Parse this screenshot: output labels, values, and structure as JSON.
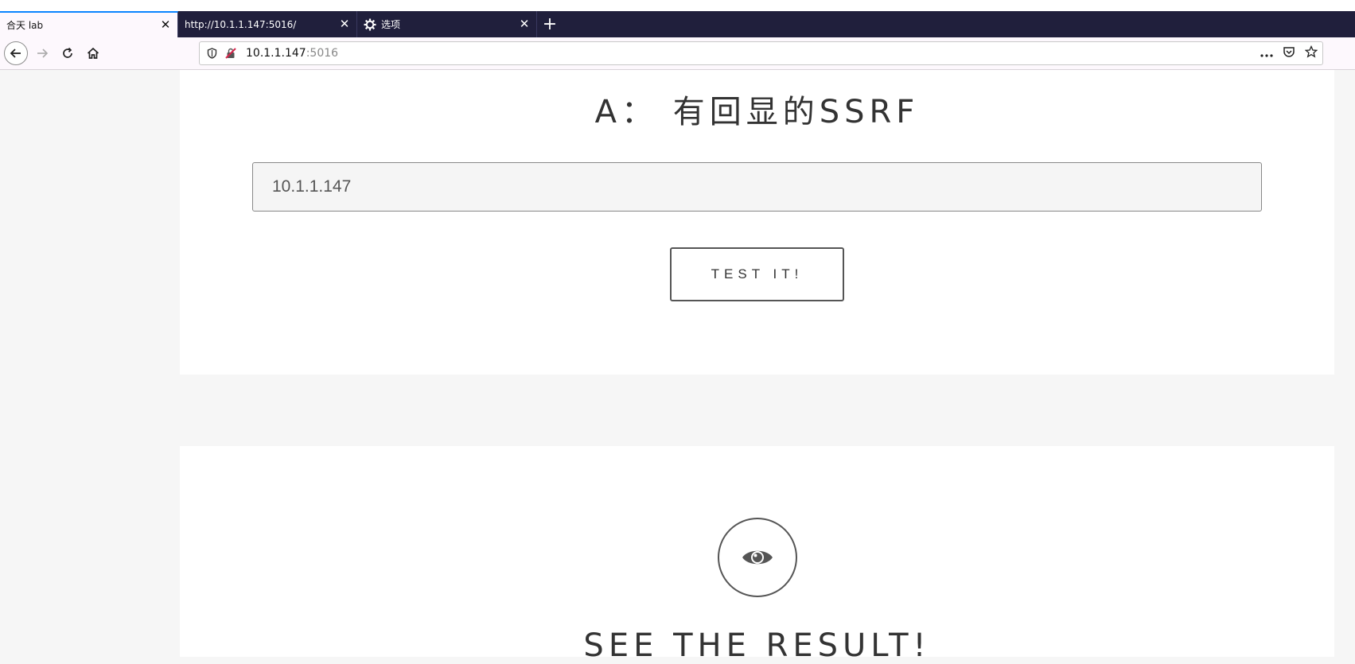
{
  "browser": {
    "tabs": [
      {
        "title": "合天 lab",
        "active": true
      },
      {
        "title": "http://10.1.1.147:5016/",
        "active": false
      },
      {
        "title": "选项",
        "active": false,
        "icon": "gear-icon"
      }
    ],
    "new_tab_label": "+",
    "address": {
      "host": "10.1.1.147",
      "port": ":5016"
    },
    "colors": {
      "tab_bar": "#201f3c",
      "active_tab": "#fdf8fd",
      "active_tab_accent": "#0a84ff"
    }
  },
  "page": {
    "heading": "A： 有回显的SSRF",
    "url_input_value": "10.1.1.147",
    "test_button_label": "TEST IT!",
    "result_icon": "eye-icon",
    "result_heading": "SEE THE RESULT!"
  }
}
